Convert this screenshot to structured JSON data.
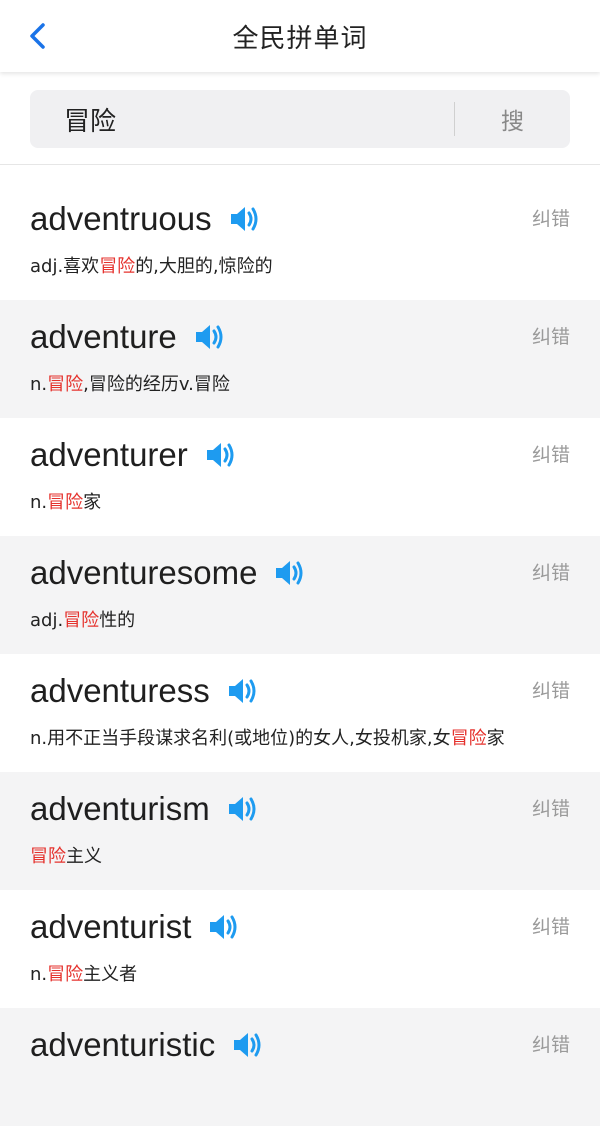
{
  "header": {
    "title": "全民拼单词",
    "back_icon": "chevron-left-icon"
  },
  "search": {
    "query": "冒险",
    "button_label": "搜"
  },
  "colors": {
    "accent": "#1a73e8",
    "highlight": "#e5322d",
    "speaker": "#1e9bf0"
  },
  "results": [
    {
      "word": "adventruous",
      "meaning_parts": [
        "adj.喜欢",
        "冒险",
        "的,大胆的,惊险的"
      ],
      "report_label": "纠错"
    },
    {
      "word": "adventure",
      "meaning_parts": [
        "n.",
        "冒险",
        ",冒险的经历v.冒险"
      ],
      "report_label": "纠错"
    },
    {
      "word": "adventurer",
      "meaning_parts": [
        "n.",
        "冒险",
        "家"
      ],
      "report_label": "纠错"
    },
    {
      "word": "adventuresome",
      "meaning_parts": [
        "adj.",
        "冒险",
        "性的"
      ],
      "report_label": "纠错"
    },
    {
      "word": "adventuress",
      "meaning_parts": [
        "n.用不正当手段谋求名利(或地位)的女人,女投机家,女",
        "冒险",
        "家"
      ],
      "report_label": "纠错"
    },
    {
      "word": "adventurism",
      "meaning_parts": [
        "",
        "冒险",
        "主义"
      ],
      "report_label": "纠错"
    },
    {
      "word": "adventurist",
      "meaning_parts": [
        "n.",
        "冒险",
        "主义者"
      ],
      "report_label": "纠错"
    },
    {
      "word": "adventuristic",
      "meaning_parts": [
        "",
        "",
        ""
      ],
      "report_label": "纠错"
    }
  ]
}
